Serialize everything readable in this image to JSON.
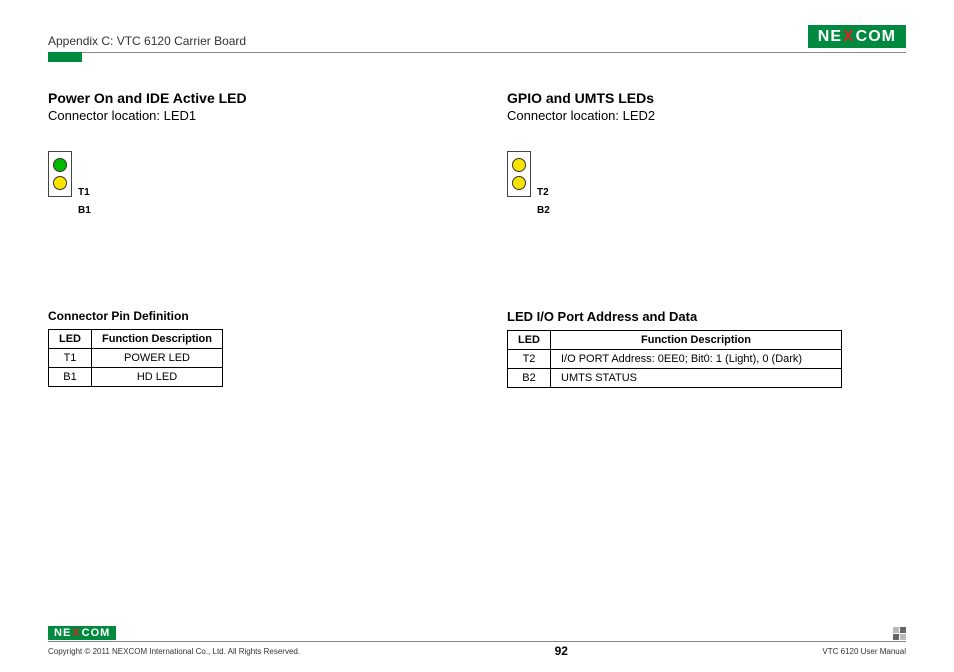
{
  "header": {
    "appendix": "Appendix C: VTC 6120 Carrier Board",
    "logo_pre": "NE",
    "logo_x": "X",
    "logo_post": "COM"
  },
  "left": {
    "title": "Power On and IDE Active LED",
    "sub": "Connector location: LED1",
    "led_top_label": "T1",
    "led_bot_label": "B1",
    "table_caption": "Connector Pin Definition",
    "table": {
      "h1": "LED",
      "h2": "Function Description",
      "rows": [
        {
          "c1": "T1",
          "c2": "POWER LED"
        },
        {
          "c1": "B1",
          "c2": "HD LED"
        }
      ]
    }
  },
  "right": {
    "title": "GPIO and UMTS LEDs",
    "sub": "Connector location: LED2",
    "led_top_label": "T2",
    "led_bot_label": "B2",
    "table_caption": "LED I/O Port Address and Data",
    "table": {
      "h1": "LED",
      "h2": "Function Description",
      "rows": [
        {
          "c1": "T2",
          "c2": "I/O PORT Address: 0EE0; Bit0: 1 (Light), 0 (Dark)"
        },
        {
          "c1": "B2",
          "c2": "UMTS STATUS"
        }
      ]
    }
  },
  "footer": {
    "copyright": "Copyright © 2011 NEXCOM International Co., Ltd. All Rights Reserved.",
    "page": "92",
    "manual": "VTC 6120 User Manual"
  }
}
